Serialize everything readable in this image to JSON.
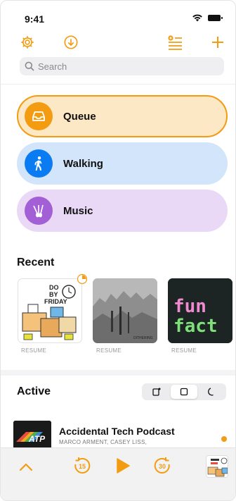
{
  "status_bar": {
    "time": "9:41"
  },
  "search": {
    "placeholder": "Search"
  },
  "playlists": [
    {
      "label": "Queue",
      "icon": "inbox-icon"
    },
    {
      "label": "Walking",
      "icon": "walking-icon"
    },
    {
      "label": "Music",
      "icon": "guitar-icon"
    }
  ],
  "recent": {
    "title": "Recent",
    "items": [
      {
        "art_text": [
          "DO",
          "BY",
          "FRIDAY"
        ],
        "resume_label": "RESUME"
      },
      {
        "art_text": [
          "DITHERING"
        ],
        "resume_label": "RESUME"
      },
      {
        "art_text": [
          "fun",
          "fact"
        ],
        "resume_label": "RESUME"
      }
    ]
  },
  "active": {
    "title": "Active",
    "segments": [
      "phone-wake-icon",
      "square-icon",
      "moon-icon"
    ],
    "selected_segment": 1
  },
  "episode": {
    "title": "Accidental Tech Podcast",
    "authors": "MARCO ARMENT, CASEY LISS,",
    "art_text": "ATP"
  },
  "colors": {
    "accent": "#f39c12",
    "queue_bg": "#fde8c5",
    "walking": "#0a7bf0",
    "walking_bg": "#d2e5fb",
    "music": "#a35fd6",
    "music_bg": "#ead9f6"
  },
  "player": {
    "skip_back_seconds": "15",
    "skip_forward_seconds": "30"
  }
}
